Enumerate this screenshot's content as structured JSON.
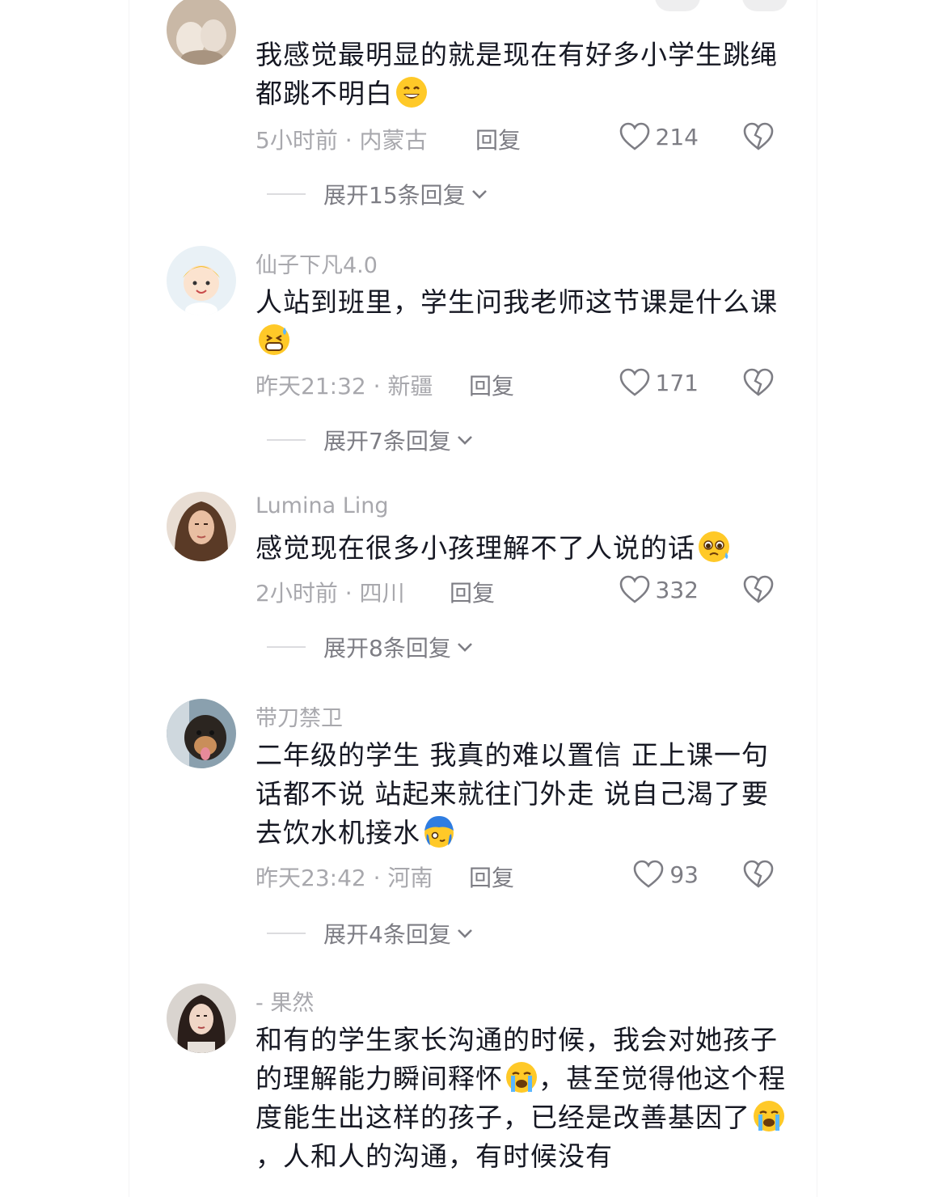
{
  "comments": [
    {
      "username": "",
      "text": "我感觉最明显的就是现在有好多小学生跳绳都跳不明白",
      "time_location": "5小时前 · 内蒙古",
      "reply_label": "回复",
      "likes": "214",
      "expand_label": "展开15条回复"
    },
    {
      "username": "仙子下凡4.0",
      "text": "人站到班里，学生问我老师这节课是什么课",
      "time_location": "昨天21:32 · 新疆",
      "reply_label": "回复",
      "likes": "171",
      "expand_label": "展开7条回复"
    },
    {
      "username": "Lumina Ling",
      "text": "感觉现在很多小孩理解不了人说的话",
      "time_location": "2小时前 · 四川",
      "reply_label": "回复",
      "likes": "332",
      "expand_label": "展开8条回复"
    },
    {
      "username": "带刀禁卫",
      "text": "二年级的学生 我真的难以置信 正上课一句话都不说 站起来就往门外走 说自己渴了要去饮水机接水",
      "time_location": "昨天23:42 · 河南",
      "reply_label": "回复",
      "likes": "93",
      "expand_label": "展开4条回复"
    },
    {
      "username": "- 果然",
      "text_parts": [
        "和有的学生家长沟通的时候，我会对她孩子的理解能力瞬间释怀",
        "，甚至觉得他这个程度能生出这样的孩子，已经是改善基因了",
        "，人和人的沟通，有时候没有"
      ]
    }
  ],
  "colors": {
    "primary_text": "#161823",
    "secondary_text": "#a8a8ad",
    "action_text": "#7d7d84"
  },
  "icons": {
    "like": "heart-outline-icon",
    "dislike": "broken-heart-icon",
    "expand": "chevron-down-icon"
  }
}
